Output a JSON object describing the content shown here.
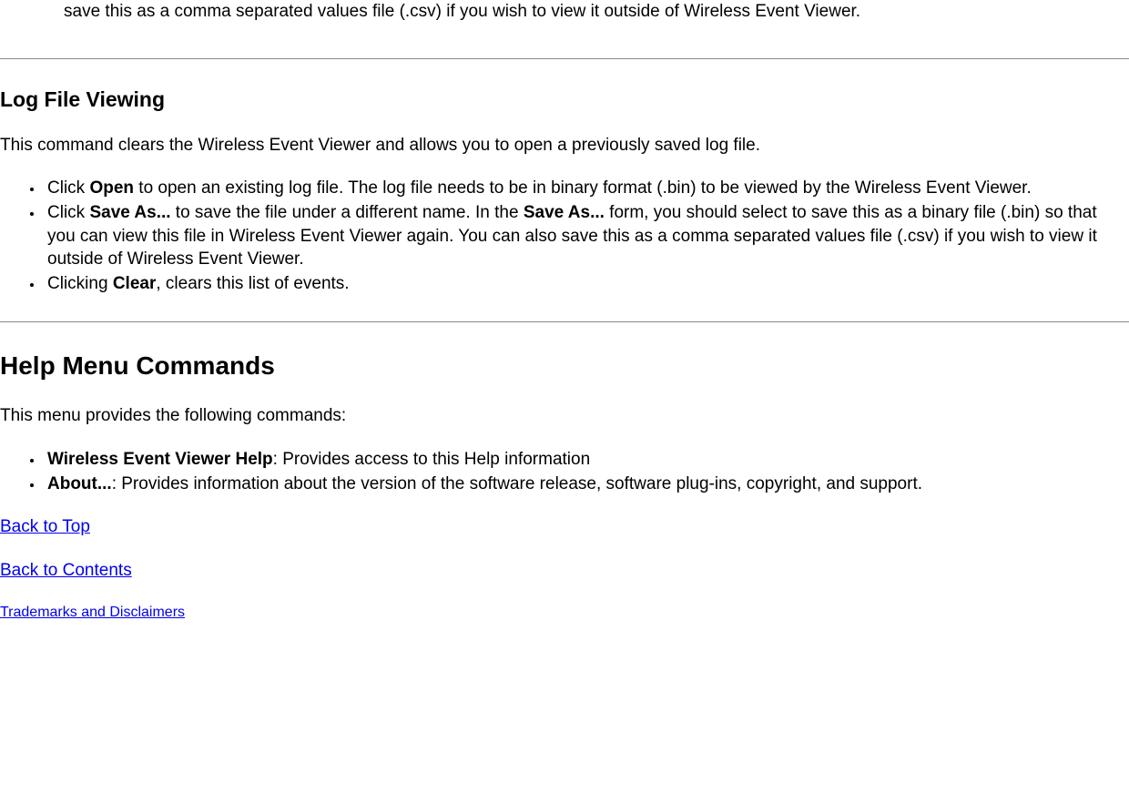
{
  "topFragment": {
    "text": "save this as a comma separated values file (.csv) if you wish to view it outside of Wireless Event Viewer."
  },
  "logFileViewing": {
    "heading": "Log File Viewing",
    "intro": "This command clears the Wireless Event Viewer and allows you to open a previously saved log file.",
    "items": [
      {
        "prefix": "Click ",
        "bold": "Open",
        "suffix": " to open an existing log file. The log file needs to be in binary format (.bin) to be viewed by the Wireless Event Viewer."
      },
      {
        "prefix": "Click ",
        "bold": "Save As...",
        "mid": " to save the file under a different name. In the ",
        "bold2": "Save As...",
        "suffix": " form, you should select to save this as a binary file (.bin) so that you can view this file in Wireless Event Viewer again. You can also save this as a comma separated values file (.csv) if you wish to view it outside of Wireless Event Viewer."
      },
      {
        "prefix": "Clicking ",
        "bold": "Clear",
        "suffix": ", clears this list of events."
      }
    ]
  },
  "helpMenu": {
    "heading": "Help Menu Commands",
    "intro": "This menu provides the following commands:",
    "items": [
      {
        "bold": "Wireless Event Viewer Help",
        "suffix": ": Provides access to this Help information"
      },
      {
        "bold": "About...",
        "suffix": ": Provides information about the version of the software release, software plug-ins, copyright, and support."
      }
    ]
  },
  "links": {
    "backToTop": "Back to Top",
    "backToContents": "Back to Contents",
    "trademarks": "Trademarks and Disclaimers"
  }
}
